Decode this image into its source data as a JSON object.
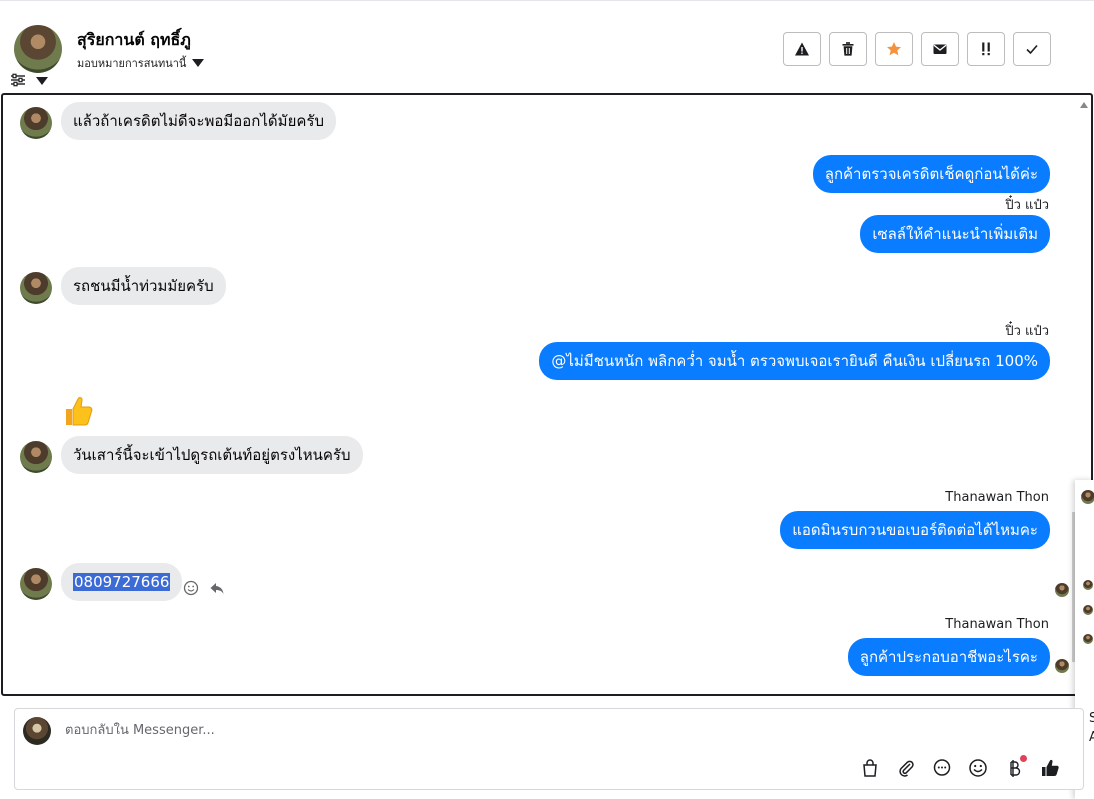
{
  "header": {
    "customer_name": "สุริยกานต์ ฤทธิ์ภู",
    "assign_label": "มอบหมายการสนทนานี้"
  },
  "actions": [
    {
      "name": "report-button",
      "icon": "warning-icon"
    },
    {
      "name": "delete-button",
      "icon": "trash-icon"
    },
    {
      "name": "star-button",
      "icon": "star-icon",
      "color": "#f5923e"
    },
    {
      "name": "mark-unread-button",
      "icon": "envelope-icon"
    },
    {
      "name": "important-button",
      "icon": "double-exclamation-icon"
    },
    {
      "name": "mark-done-button",
      "icon": "check-icon"
    }
  ],
  "messages": {
    "m1": {
      "text": "แล้วถ้าเครดิตไม่ดีจะพอมีออกได้มัยครับ"
    },
    "m2": {
      "text": "ลูกค้าตรวจเครดิตเช็คดูก่อนได้ค่ะ"
    },
    "m3": {
      "sender": "ปิ๋ว แป๋ว",
      "text": "เซลล์ให้คำแนะนำเพิ่มเติม"
    },
    "m4": {
      "text": "รถชนมีน้ำท่วมมัยครับ"
    },
    "m5": {
      "sender": "ปิ๋ว แป๋ว",
      "text": "@ไม่มีชนหนัก พลิกคว่ำ จมน้ำ ตรวจพบเจอเรายินดี คืนเงิน เปลี่ยนรถ 100%"
    },
    "m6": {
      "emoji": "👍"
    },
    "m7": {
      "text": "วันเสาร์นี้จะเข้าไปดูรถเต้นท์อยู่ตรงไหนครับ"
    },
    "m8": {
      "sender": "Thanawan Thon",
      "text": "แอดมินรบกวนขอเบอร์ติดต่อได้ไหมคะ"
    },
    "m9": {
      "text": "0809727666"
    },
    "m10": {
      "sender": "Thanawan Thon",
      "text": "ลูกค้าประกอบอาชีพอะไรคะ"
    }
  },
  "side_panel": {
    "line1": "S",
    "line2": "A"
  },
  "composer": {
    "placeholder": "ตอบกลับใน Messenger..."
  },
  "composer_tools": [
    "shopping-bag-icon",
    "paperclip-icon",
    "chat-bubble-icon",
    "emoji-icon",
    "baht-icon",
    "thumbs-up-icon"
  ],
  "colors": {
    "outgoing_bubble": "#0a7cff",
    "incoming_bubble": "#e9eaec",
    "star_accent": "#f5923e",
    "notification_dot": "#e0415a"
  }
}
